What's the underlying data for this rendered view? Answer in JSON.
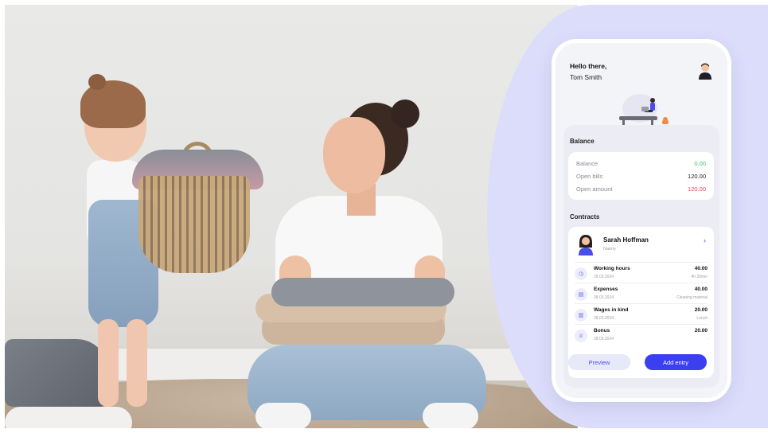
{
  "phone": {
    "greeting": "Hello there,",
    "user_name": "Tom Smith",
    "balance_section": {
      "title": "Balance",
      "rows": [
        {
          "label": "Balance",
          "value": "0.00",
          "status": "positive"
        },
        {
          "label": "Open bills",
          "value": "120.00",
          "status": "neutral"
        },
        {
          "label": "Open amount",
          "value": "120.00",
          "status": "negative"
        }
      ]
    },
    "contracts_section": {
      "title": "Contracts",
      "person": {
        "name": "Sarah Hoffman",
        "role": "Nanny"
      },
      "items": [
        {
          "title": "Working hours",
          "date": "28.03.2024",
          "amount": "40.00",
          "note": "4h 30min",
          "icon": "clock-icon"
        },
        {
          "title": "Expenses",
          "date": "28.03.2024",
          "amount": "40.00",
          "note": "Cleaning material",
          "icon": "receipt-icon"
        },
        {
          "title": "Wages in kind",
          "date": "28.03.2024",
          "amount": "20.00",
          "note": "Lunch",
          "icon": "gift-icon"
        },
        {
          "title": "Bonus",
          "date": "28.03.2024",
          "amount": "20.00",
          "note": "-",
          "icon": "trophy-icon"
        }
      ]
    },
    "buttons": {
      "preview": "Preview",
      "add_entry": "Add entry"
    }
  },
  "colors": {
    "accent": "#3b3ff0",
    "panel": "#dcdcfb",
    "positive": "#3fb870",
    "negative": "#e5484d"
  }
}
